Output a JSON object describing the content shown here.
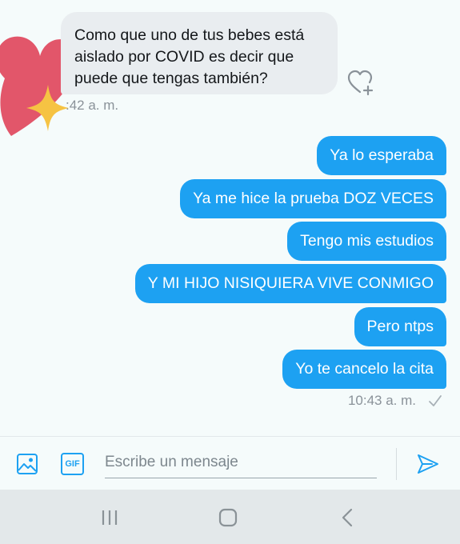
{
  "conversation": {
    "incoming_message": {
      "lines": [
        "Como que uno de tus bebes está",
        "aislado por COVID es decir que",
        "puede que tengas también?"
      ],
      "time": "10:42 a. m.",
      "time_visible": ":42 a. m."
    },
    "outgoing_messages": [
      {
        "text": "Ya lo esperaba"
      },
      {
        "text": "Ya me hice la prueba DOZ VECES"
      },
      {
        "text": "Tengo mis estudios"
      },
      {
        "text": "Y MI HIJO NISIQUIERA VIVE CONMIGO"
      },
      {
        "text": "Pero ntps"
      },
      {
        "text": "Yo te cancelo la cita"
      }
    ],
    "outgoing_time": "10:43 a. m."
  },
  "composer": {
    "placeholder": "Escribe un mensaje",
    "gif_label": "GIF"
  },
  "colors": {
    "accent": "#1da1f2",
    "incoming_bubble": "#e9edf0",
    "background": "#f5fbfb"
  },
  "icons": {
    "media": "image-icon",
    "gif": "gif-icon",
    "send": "send-icon",
    "react": "heart-add-icon",
    "read_receipt": "checkmark-icon",
    "nav_recents": "recents-icon",
    "nav_home": "home-icon",
    "nav_back": "back-icon"
  }
}
